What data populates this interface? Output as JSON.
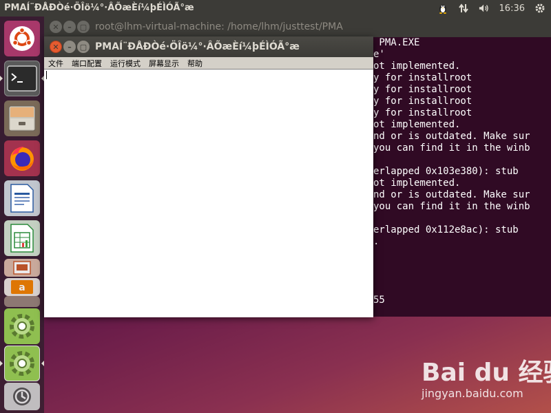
{
  "top_panel": {
    "app_title": "PMAÍ¨ÐÅÐÒé·ÖÎö¼°·ÂÕæÈí¼þÉÌÓÃ°æ",
    "clock": "16:36",
    "tray_icons": [
      "linux-tux-icon",
      "network-arrows-icon",
      "volume-icon"
    ]
  },
  "launcher": {
    "items": [
      "ubuntu-dash-icon",
      "terminal-icon",
      "files-icon",
      "firefox-icon",
      "libreoffice-writer-icon",
      "libreoffice-calc-icon",
      "libreoffice-impress-icon",
      "amazon-icon",
      "wine-gear-icon",
      "wine-gear-icon",
      "software-updater-icon"
    ]
  },
  "terminal": {
    "title": "root@lhm-virtual-machine: /home/lhm/justtest/PMA",
    "lines": [
      " PMA.EXE",
      "e'",
      "ot implemented.",
      "y for installroot",
      "y for installroot",
      "y for installroot",
      "y for installroot",
      "ot implemented.",
      "nd or is outdated. Make sur",
      "you can find it in the winb",
      "",
      "erlapped 0x103e380): stub",
      "ot implemented.",
      "nd or is outdated. Make sur",
      "you can find it in the winb",
      "",
      "erlapped 0x112e8ac): stub",
      ".",
      "",
      "",
      "",
      "",
      "55"
    ]
  },
  "pma_window": {
    "title": "PMAÍ¨ÐÅÐÒé·ÖÎö¼°·ÂÕæÈí¼þÉÌÓÃ°æ",
    "menu": [
      "文件",
      "端口配置",
      "运行模式",
      "屏幕显示",
      "帮助"
    ]
  },
  "watermark": {
    "logo": "Bai du 经验",
    "url": "jingyan.baidu.com"
  },
  "colors": {
    "panel": "#3c3b37",
    "terminal_bg": "#300a24",
    "close_button": "#e65b2f"
  }
}
